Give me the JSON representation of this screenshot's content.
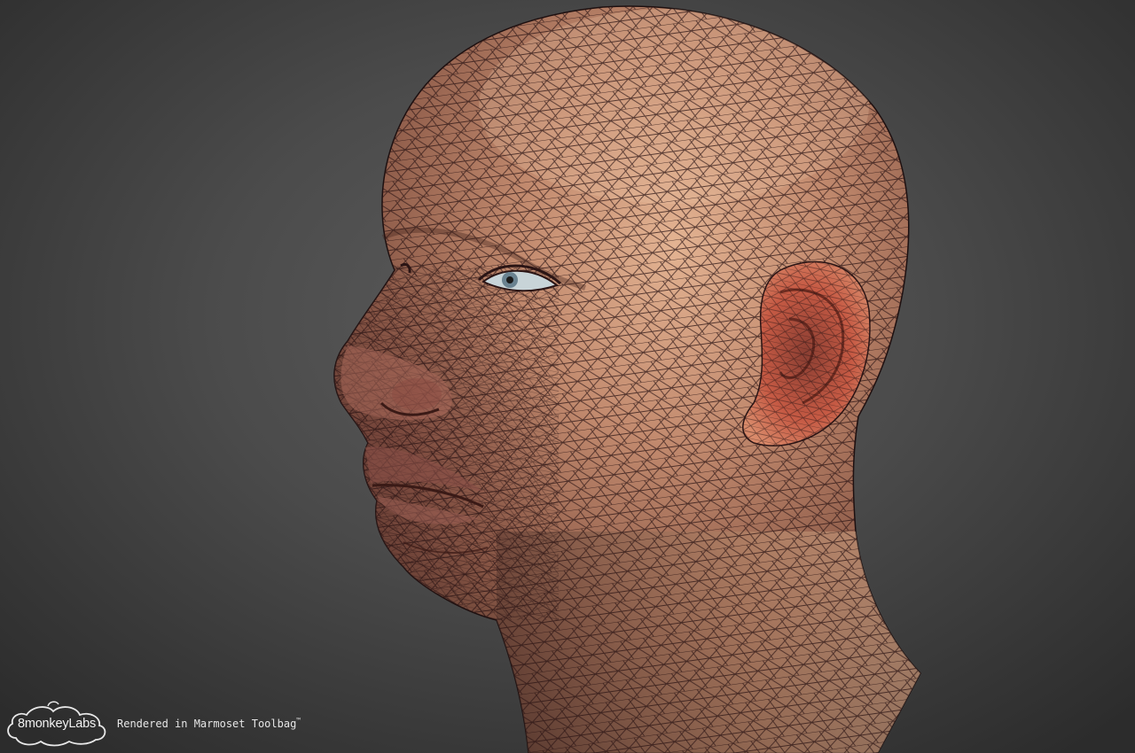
{
  "scene": {
    "subject": "wireframe-head-render",
    "colors": {
      "background": "#4a4a4a",
      "skin": "#b98068",
      "skin_highlight": "#e0b08c",
      "ear": "#c86048",
      "wire": "#2a1414"
    }
  },
  "watermark": {
    "logo_text": "8monkeyLabs",
    "caption": "Rendered in Marmoset Toolbag",
    "trademark": "™"
  }
}
